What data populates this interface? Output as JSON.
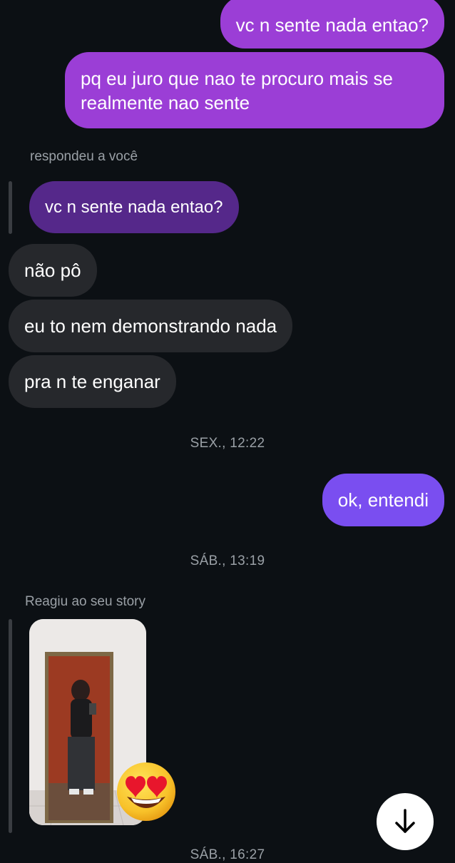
{
  "thread": {
    "sent_1": "vc n sente nada entao?",
    "sent_2": "pq eu juro que nao te procuro mais se realmente nao sente",
    "reply_meta": "respondeu a você",
    "quoted": "vc n sente nada entao?",
    "recv_1": "não pô",
    "recv_2": "eu to nem demonstrando nada",
    "recv_3": "pra n te enganar",
    "timestamp_1": "SEX., 12:22",
    "sent_3": "ok, entendi",
    "timestamp_2": "SÁB., 13:19",
    "story_meta": "Reagiu ao seu story",
    "reaction": "😍",
    "timestamp_3_partial": "SÁB., 16:27"
  },
  "colors": {
    "background": "#0c1014",
    "sent_top": "#9a3fd4",
    "sent_bottom": "#7b4be8",
    "received": "#26282c",
    "quoted": "#5a2a8c"
  },
  "icons": {
    "scroll_down": "arrow-down-icon"
  }
}
